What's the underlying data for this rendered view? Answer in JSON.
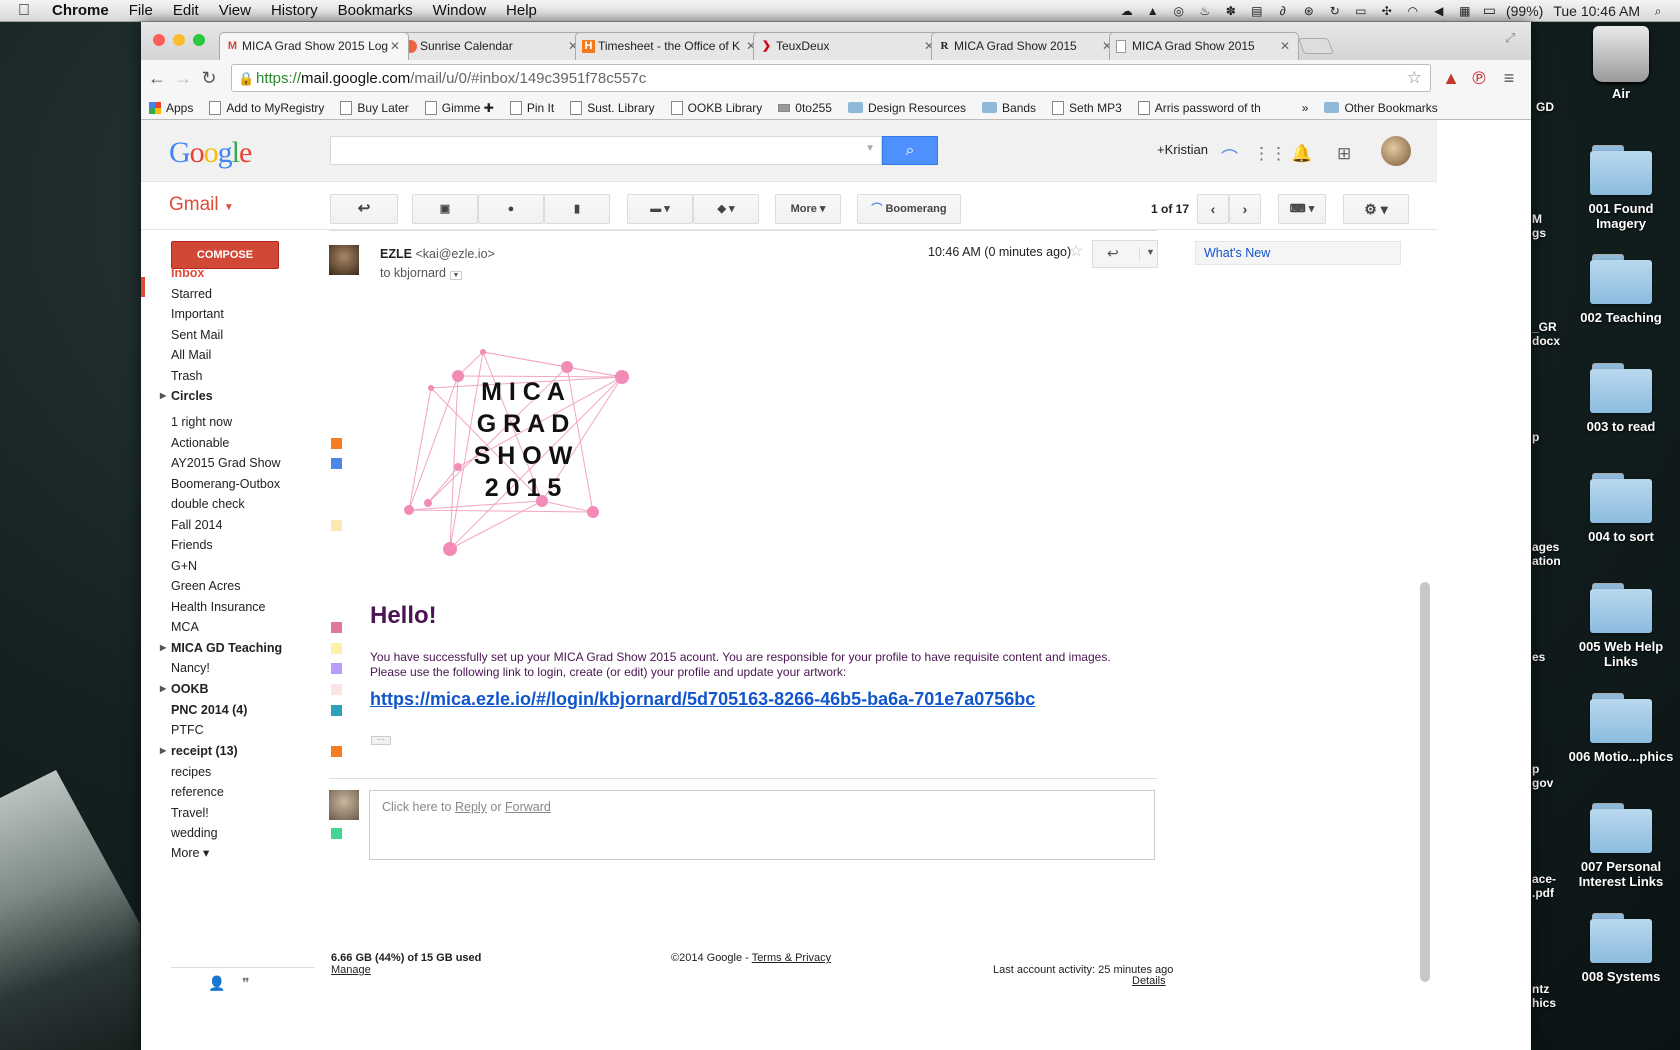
{
  "menubar": {
    "app": "Chrome",
    "items": [
      "File",
      "Edit",
      "View",
      "History",
      "Bookmarks",
      "Window",
      "Help"
    ],
    "battery": "(99%)",
    "clock": "Tue 10:46 AM"
  },
  "desktop": {
    "drive_label": "Air",
    "folders": [
      "001 Found Imagery",
      "002 Teaching",
      "003 to read",
      "004 to sort",
      "005 Web Help Links",
      "006 Motio...phics",
      "007 Personal Interest Links",
      "008 Systems"
    ],
    "partial_labels": [
      "GD",
      "M gs",
      "_GR docx",
      "p",
      "ages ation",
      "es",
      "p gov",
      "ace- .pdf",
      "ntz hics"
    ]
  },
  "browser": {
    "tabs": [
      {
        "title": "MICA Grad Show 2015 Log",
        "icon": "gmail-icon"
      },
      {
        "title": "Sunrise Calendar",
        "icon": "sunrise-icon"
      },
      {
        "title": "Timesheet - the Office of K",
        "icon": "harvest-icon"
      },
      {
        "title": "TeuxDeux",
        "icon": "teuxdeux-icon"
      },
      {
        "title": "MICA Grad Show 2015",
        "icon": "r-icon"
      },
      {
        "title": "MICA Grad Show 2015",
        "icon": "doc-icon"
      }
    ],
    "url_scheme": "https://",
    "url_host": "mail.google.com",
    "url_path": "/mail/u/0/#inbox/149c3951f78c557c",
    "bookmarks": [
      "Apps",
      "Add to MyRegistry",
      "Buy Later",
      "Gimme ✚",
      "Pin It",
      "Sust. Library",
      "OOKB Library",
      "0to255",
      "Design Resources",
      "Bands",
      "Seth MP3",
      "Arris password of th"
    ],
    "other_bookmarks": "Other Bookmarks",
    "bookmark_overflow": "»"
  },
  "gmail": {
    "user": "+Kristian",
    "label": "Gmail",
    "compose": "COMPOSE",
    "more": "More",
    "boomerang": "Boomerang",
    "pager": "1 of 17",
    "nav": [
      {
        "label": "Inbox",
        "style": "active"
      },
      {
        "label": "Starred"
      },
      {
        "label": "Important"
      },
      {
        "label": "Sent Mail"
      },
      {
        "label": "All Mail"
      },
      {
        "label": "Trash"
      },
      {
        "label": "Circles",
        "style": "bold",
        "arrow": true
      }
    ],
    "labels": [
      {
        "label": "1 right now"
      },
      {
        "label": "Actionable",
        "color": "#f57c1f"
      },
      {
        "label": "AY2015 Grad Show",
        "color": "#4a86e8"
      },
      {
        "label": "Boomerang-Outbox"
      },
      {
        "label": "double check"
      },
      {
        "label": "Fall 2014",
        "color": "#fce8b3"
      },
      {
        "label": "Friends"
      },
      {
        "label": "G+N"
      },
      {
        "label": "Green Acres"
      },
      {
        "label": "Health Insurance"
      },
      {
        "label": "MCA",
        "color": "#e07798"
      },
      {
        "label": "MICA GD Teaching",
        "color": "#fef1a8",
        "style": "bold",
        "arrow": true
      },
      {
        "label": "Nancy!",
        "color": "#b99aff"
      },
      {
        "label": "OOKB",
        "color": "#fde4e4",
        "style": "bold",
        "arrow": true
      },
      {
        "label": "PNC 2014 (4)",
        "color": "#2da2bb",
        "style": "bold"
      },
      {
        "label": "PTFC"
      },
      {
        "label": "receipt (13)",
        "color": "#f57c1f",
        "style": "bold",
        "arrow": true
      },
      {
        "label": "recipes"
      },
      {
        "label": "reference"
      },
      {
        "label": "Travel!"
      },
      {
        "label": "wedding",
        "color": "#43d692"
      }
    ],
    "more_label": "More ▾",
    "whats_new": "What's New"
  },
  "message": {
    "sender_name": "EZLE",
    "sender_email": "<kai@ezle.io>",
    "to": "to kbjornard",
    "time": "10:46 AM (0 minutes ago)",
    "logo_lines": [
      "M I C A",
      "G R A D",
      "S H O W",
      "2 0 1 5"
    ],
    "hello": "Hello!",
    "line1": "You have successfully set up your MICA Grad Show 2015 acount. You are responsible for your profile to have requisite content and images.",
    "line2": "Please use the following link to login, create (or edit) your profile and update your artwork:",
    "link": "https://mica.ezle.io/#/login/kbjornard/5d705163-8266-46b5-ba6a-701e7a0756bc",
    "reply_prefix": "Click here to",
    "reply": "Reply",
    "reply_or": "or",
    "forward": "Forward"
  },
  "footer": {
    "storage": "6.66 GB (44%) of 15 GB used",
    "manage": "Manage",
    "copyright": "©2014 Google -",
    "terms": "Terms & Privacy",
    "activity": "Last account activity: 25 minutes ago",
    "details": "Details"
  }
}
